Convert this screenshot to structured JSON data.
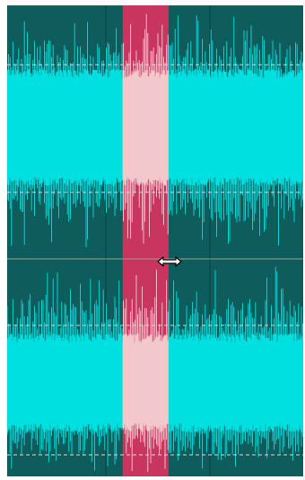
{
  "editor": {
    "channels": [
      {
        "id": "left"
      },
      {
        "id": "right"
      }
    ],
    "selection": {
      "start_fraction": 0.39,
      "end_fraction": 0.545
    },
    "colors": {
      "background": "#0e5c5c",
      "waveform": "#00e0e0",
      "selection_fill": "#c83660",
      "selection_waveform": "#f2c8cc",
      "divider": "#9a9a8c",
      "reference_line": "#d9d9d9",
      "grid": "#0a4444"
    },
    "cursor": {
      "icon": "resize-horizontal-icon"
    }
  }
}
